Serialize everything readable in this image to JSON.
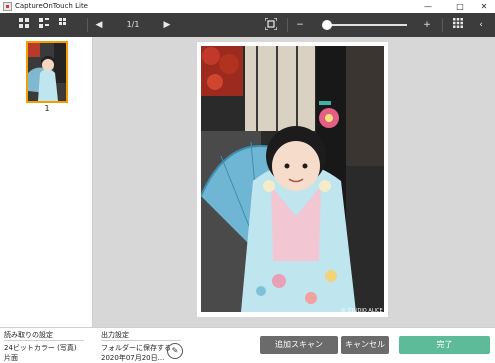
{
  "window": {
    "title": "CaptureOnTouch Lite"
  },
  "toolbar": {
    "page_indicator": "1/1"
  },
  "sidebar": {
    "thumbnails": [
      {
        "number": "1"
      }
    ]
  },
  "bottom": {
    "scan_settings_label": "読み取りの設定",
    "color_mode": "24ビットカラー (写真)",
    "sides": "片面",
    "output_settings_label": "出力設定",
    "output_action": "フォルダーに保存する",
    "output_file": "2020年07月20日...",
    "add_scan_label": "追加スキャン",
    "cancel_label": "キャンセル",
    "done_label": "完了"
  },
  "photo": {
    "watermark": "© STUDIO ALICE"
  },
  "colors": {
    "done_button": "#5dbb9a",
    "secondary_button": "#6b6b6b",
    "toolbar": "#3c3c3c",
    "thumbnail_selection": "#f0a000"
  }
}
